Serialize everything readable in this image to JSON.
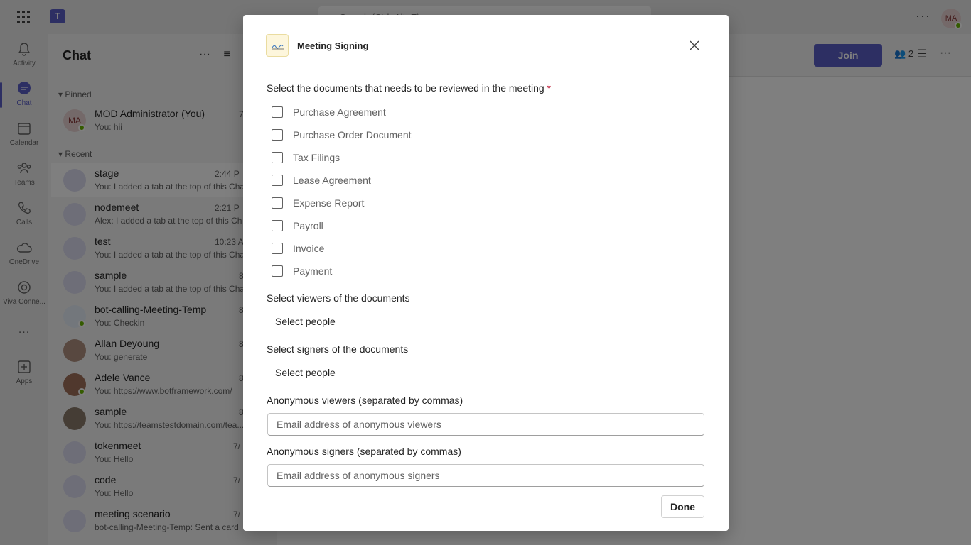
{
  "app": {
    "search_placeholder": "Search (Ctrl+Alt+E)",
    "user_initials": "MA"
  },
  "rail": [
    {
      "label": "Activity",
      "icon": "bell-icon"
    },
    {
      "label": "Chat",
      "icon": "chat-icon"
    },
    {
      "label": "Calendar",
      "icon": "calendar-icon"
    },
    {
      "label": "Teams",
      "icon": "teams-icon"
    },
    {
      "label": "Calls",
      "icon": "phone-icon"
    },
    {
      "label": "OneDrive",
      "icon": "cloud-icon"
    },
    {
      "label": "Viva Conne...",
      "icon": "viva-icon"
    },
    {
      "label": "...",
      "icon": "more-icon"
    },
    {
      "label": "Apps",
      "icon": "add-app-icon"
    }
  ],
  "chat": {
    "title": "Chat",
    "pinned_label": "Pinned",
    "recent_label": "Recent",
    "pinned": [
      {
        "initials": "MA",
        "name": "MOD Administrator (You)",
        "preview": "You: hii",
        "time": "7"
      }
    ],
    "recent": [
      {
        "name": "stage",
        "preview": "You: I added a tab at the top of this Chat",
        "time": "2:44 P"
      },
      {
        "name": "nodemeet",
        "preview": "Alex: I added a tab at the top of this Ch",
        "time": "2:21 P"
      },
      {
        "name": "test",
        "preview": "You: I added a tab at the top of this Chat",
        "time": "10:23 A"
      },
      {
        "name": "sample",
        "preview": "You: I added a tab at the top of this Chat",
        "time": "8"
      },
      {
        "name": "bot-calling-Meeting-Temp",
        "preview": "You: Checkin",
        "time": "8"
      },
      {
        "name": "Allan Deyoung",
        "preview": "You: generate",
        "time": "8"
      },
      {
        "name": "Adele Vance",
        "preview": "You: https://www.botframework.com/",
        "time": "8"
      },
      {
        "name": "sample",
        "preview": "You: https://teamstestdomain.com/tea...",
        "time": "8"
      },
      {
        "name": "tokenmeet",
        "preview": "You: Hello",
        "time": "7/"
      },
      {
        "name": "code",
        "preview": "You: Hello",
        "time": "7/"
      },
      {
        "name": "meeting scenario",
        "preview": "bot-calling-Meeting-Temp: Sent a card",
        "time": "7/"
      }
    ]
  },
  "meeting": {
    "join_label": "Join",
    "participant_count": "2"
  },
  "dialog": {
    "title": "Meeting Signing",
    "documents_label": "Select the documents that needs to be reviewed in the meeting",
    "required_mark": "*",
    "documents": [
      "Purchase Agreement",
      "Purchase Order Document",
      "Tax Filings",
      "Lease Agreement",
      "Expense Report",
      "Payroll",
      "Invoice",
      "Payment"
    ],
    "viewers_label": "Select viewers of the documents",
    "viewers_picker": "Select people",
    "signers_label": "Select signers of the documents",
    "signers_picker": "Select people",
    "anon_viewers_label": "Anonymous viewers (separated by commas)",
    "anon_viewers_placeholder": "Email address of anonymous viewers",
    "anon_signers_label": "Anonymous signers (separated by commas)",
    "anon_signers_placeholder": "Email address of anonymous signers",
    "done_label": "Done"
  }
}
